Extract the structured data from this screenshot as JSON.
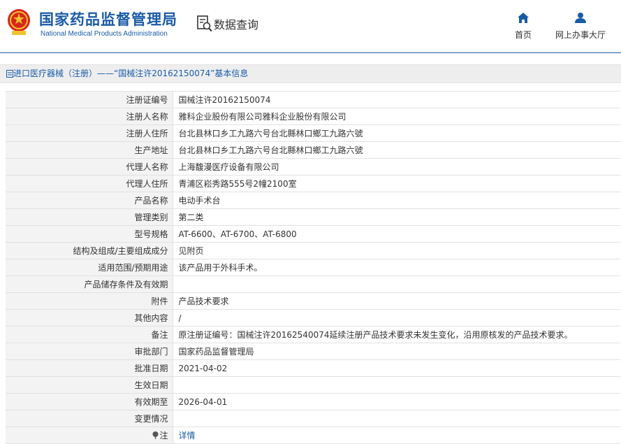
{
  "header": {
    "title_cn": "国家药品监督管理局",
    "title_en": "National Medical Products Administration",
    "query_label": "数据查询",
    "query_icon": "data-search-icon",
    "nav": [
      {
        "label": "首页",
        "icon": "home-icon"
      },
      {
        "label": "网上办事大厅",
        "icon": "user-icon"
      }
    ]
  },
  "breadcrumb": {
    "icon": "document-icon",
    "text": "进口医疗器械（注册）——“国械注许20162150074”基本信息"
  },
  "colors": {
    "brand": "#1a5ba6",
    "label_bg": "#f3f3f3"
  },
  "detail": [
    {
      "label": "注册证编号",
      "value": "国械注许20162150074"
    },
    {
      "label": "注册人名称",
      "value": "雅科企业股份有限公司雅科企业股份有限公司"
    },
    {
      "label": "注册人住所",
      "value": "台北县林口乡工九路六号台北縣林口鄉工九路六號"
    },
    {
      "label": "生产地址",
      "value": "台北县林口乡工九路六号台北縣林口鄉工九路六號"
    },
    {
      "label": "代理人名称",
      "value": "上海馥漫医疗设备有限公司"
    },
    {
      "label": "代理人住所",
      "value": "青浦区崧秀路555号2幢2100室"
    },
    {
      "label": "产品名称",
      "value": "电动手术台"
    },
    {
      "label": "管理类别",
      "value": "第二类"
    },
    {
      "label": "型号规格",
      "value": "AT-6600、AT-6700、AT-6800"
    },
    {
      "label": "结构及组成/主要组成成分",
      "value": "见附页"
    },
    {
      "label": "适用范围/预期用途",
      "value": "该产品用于外科手术。"
    },
    {
      "label": "产品储存条件及有效期",
      "value": ""
    },
    {
      "label": "附件",
      "value": "产品技术要求"
    },
    {
      "label": "其他内容",
      "value": "/"
    },
    {
      "label": "备注",
      "value": "原注册证编号：国械注许20162540074延续注册产品技术要求未发生变化，沿用原核发的产品技术要求。"
    },
    {
      "label": "审批部门",
      "value": "国家药品监督管理局"
    },
    {
      "label": "批准日期",
      "value": "2021-04-02"
    },
    {
      "label": "生效日期",
      "value": ""
    },
    {
      "label": "有效期至",
      "value": "2026-04-01"
    },
    {
      "label": "变更情况",
      "value": ""
    }
  ],
  "note_row": {
    "label": "注",
    "icon": "pin-icon",
    "link": "详情"
  }
}
